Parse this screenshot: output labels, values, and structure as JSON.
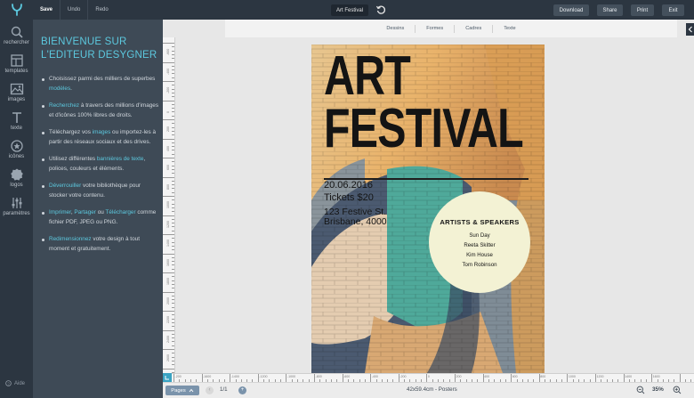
{
  "topbar": {
    "save": "Save",
    "undo": "Undo",
    "redo": "Redo",
    "doc_title": "Art Festival",
    "buttons": [
      "Download",
      "Share",
      "Print",
      "Exit"
    ]
  },
  "rail": {
    "items": [
      {
        "label": "rechercher",
        "icon": "search-icon"
      },
      {
        "label": "templates",
        "icon": "templates-icon"
      },
      {
        "label": "images",
        "icon": "image-icon"
      },
      {
        "label": "texte",
        "icon": "text-icon"
      },
      {
        "label": "icônes",
        "icon": "icons-icon"
      },
      {
        "label": "logos",
        "icon": "logos-icon"
      },
      {
        "label": "paramètres",
        "icon": "settings-icon"
      }
    ],
    "help": "Aide"
  },
  "panel": {
    "title": "BIENVENUE SUR L'EDITEUR DESYGNER",
    "items": [
      {
        "before": "Choisissez parmi des milliers de superbes ",
        "link": "modèles",
        "after": "."
      },
      {
        "before": "",
        "link": "Recherchez",
        "after": " à travers des millions d'images et d'icônes 100% libres de droits."
      },
      {
        "before": "Téléchargez vos ",
        "link": "images",
        "after": " ou importez-les à partir des réseaux sociaux et des drives."
      },
      {
        "before": "Utilisez différentes ",
        "link": "bannières de texte",
        "after": ", polices, couleurs et éléments."
      },
      {
        "before": "",
        "link": "Déverrouiller",
        "after": " votre bibliothèque pour stocker votre contenu."
      },
      {
        "before": "",
        "link": "Imprimer",
        "after": ", ",
        "link2": "Partager",
        "after2": " ou ",
        "link3": "Télécharger",
        "after3": " comme fichier PDF, JPEG ou PNG."
      },
      {
        "before": "",
        "link": "Redimensionnez",
        "after": " votre design à tout moment et gratuitement."
      }
    ]
  },
  "subtabs": [
    "Dessins",
    "Formes",
    "Cadres",
    "Texte"
  ],
  "rulers": {
    "horizontal": [
      "-200",
      "-1600",
      "-1400",
      "-1200",
      "-1000",
      "-800",
      "-600",
      "-400",
      "-200",
      "0",
      "200",
      "400",
      "600",
      "800",
      "1000",
      "1200",
      "1400",
      "1600"
    ],
    "vertical": [
      "-600",
      "-400",
      "-200",
      "0",
      "200",
      "400",
      "600",
      "800",
      "1000",
      "1200",
      "1400",
      "1600",
      "1800",
      "2000",
      "2200",
      "2400",
      "2600",
      "2800"
    ]
  },
  "bottombar": {
    "pages_label": "Pages",
    "page_count": "1/1",
    "size_info": "42x59.4cm - Posters",
    "zoom": "35%"
  },
  "poster": {
    "title_line1": "ART",
    "title_line2": "FESTIVAL",
    "date": "20.06.2016",
    "tickets": "Tickets $20",
    "address1": "123 Festive St.",
    "address2": "Brisbane, 4000",
    "circle_title": "ARTISTS & SPEAKERS",
    "speakers": [
      "Sun Day",
      "Reeta Skitter",
      "Kim House",
      "Tom Robinson"
    ]
  },
  "colors": {
    "accent": "#5cc8de",
    "topbar": "#2c3641",
    "panel": "#3e4a56",
    "circle": "#f3f2d4"
  }
}
